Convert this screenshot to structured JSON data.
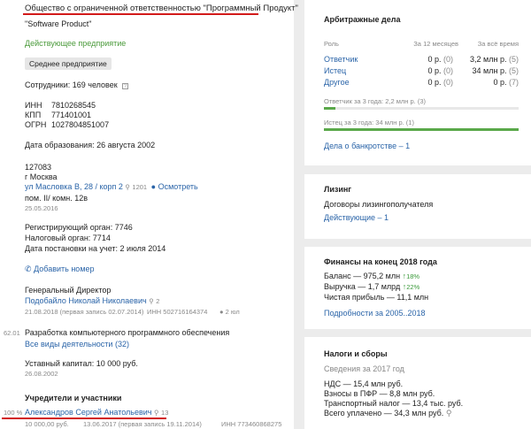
{
  "company": {
    "full_name": "Общество с ограниченной ответственностью \"Программный Продукт\"",
    "short_name": "\"Software Product\"",
    "status": "Действующее предприятие",
    "size_badge": "Среднее предприятие",
    "employees": "Сотрудники: 169 человек",
    "inn_label": "ИНН",
    "inn": "7810268545",
    "kpp_label": "КПП",
    "kpp": "771401001",
    "ogrn_label": "ОГРН",
    "ogrn": "1027804851007",
    "founded": "Дата образования: 26 августа 2002",
    "address": {
      "zip": "127083",
      "city": "г Москва",
      "street": "ул Масловка В, 28 / корп 2",
      "count": "1201",
      "map_link": "Осмотреть",
      "room": "пом. II/ комн. 12в",
      "date": "25.05.2016"
    },
    "reg_authority": "Регистрирующий орган: 7746",
    "tax_authority": "Налоговый орган: 7714",
    "tax_date": "Дата постановки на учет: 2 июля 2014",
    "add_phone": "Добавить номер",
    "director_title": "Генеральный Директор",
    "director_name": "Подобайло Николай Николаевич",
    "director_count": "2",
    "director_date": "21.08.2018 (первая запись 02.07.2014)",
    "director_inn": "ИНН 502716164374",
    "director_extra": "2 юл",
    "activity_code": "62.01",
    "activity": "Разработка компьютерного программного обеспечения",
    "activity_link": "Все виды деятельности (32)",
    "capital": "Уставный капитал: 10 000 руб.",
    "capital_date": "26.08.2002",
    "founders_title": "Учредители и участники",
    "founder_share": "100 %",
    "founder_name": "Александров Сергей Анатольевич",
    "founder_count": "13",
    "founder_sum": "10 000,00 руб.",
    "founder_date": "13.06.2017 (первая запись 19.11.2014)",
    "founder_inn": "ИНН 773460868275"
  },
  "arbitration": {
    "title": "Арбитражные дела",
    "headers": [
      "Роль",
      "За 12 месяцев",
      "За всё время"
    ],
    "rows": [
      {
        "role": "Ответчик",
        "m12": "0 р.",
        "m12n": "(0)",
        "all": "3,2 млн р.",
        "alln": "(5)"
      },
      {
        "role": "Истец",
        "m12": "0 р.",
        "m12n": "(0)",
        "all": "34 млн р.",
        "alln": "(5)"
      },
      {
        "role": "Другое",
        "m12": "0 р.",
        "m12n": "(0)",
        "all": "0 р.",
        "alln": "(7)"
      }
    ],
    "defendant_3y": "Ответчик за 3 года: 2,2 млн р. (3)",
    "defendant_3y_fraction": 0.06,
    "plaintiff_3y": "Истец за 3 года: 34 млн р. (1)",
    "plaintiff_3y_fraction": 1.0,
    "bankruptcy": "Дела о банкротстве – 1"
  },
  "leasing": {
    "title": "Лизинг",
    "subtitle": "Договоры лизингополучателя",
    "link": "Действующие – 1"
  },
  "finance": {
    "title": "Финансы на конец 2018 года",
    "balance": "Баланс — 975,2 млн",
    "balance_change": "18%",
    "revenue": "Выручка — 1,7 млрд",
    "revenue_change": "22%",
    "profit": "Чистая прибыль — 11,1 млн",
    "link": "Подробности за 2005..2018"
  },
  "taxes": {
    "title": "Налоги и сборы",
    "subtitle": "Сведения за 2017 год",
    "nds": "НДС — 15,4 млн руб.",
    "pfr": "Взносы в ПФР — 8,8 млн руб.",
    "transport": "Транспортный налог — 13,4 тыс. руб.",
    "total": "Всего уплачено — 34,3 млн руб."
  },
  "colors": {
    "accent_underline": "#d21a1a",
    "link": "#2a64a8",
    "bar_fill": "#5aa84a"
  }
}
